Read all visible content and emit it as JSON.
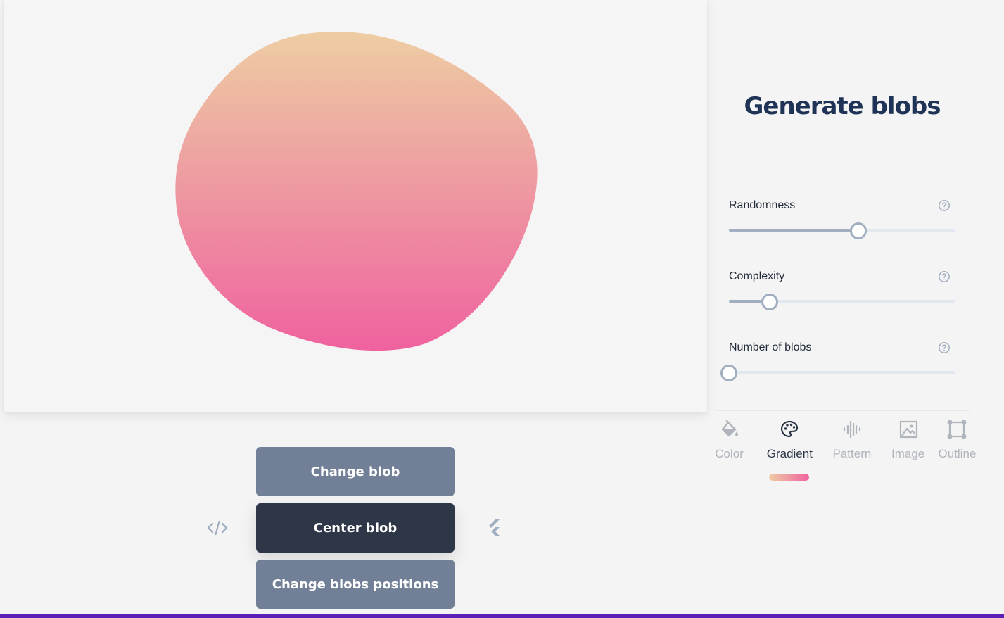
{
  "canvas": {
    "blob": {
      "gradient_start": "#eecda3",
      "gradient_end": "#ef629f"
    }
  },
  "actions": {
    "change_blob": "Change blob",
    "center_blob": "Center blob",
    "change_positions": "Change blobs positions",
    "code_icon": "code-icon",
    "flutter_icon": "flutter-icon"
  },
  "panel": {
    "title": "Generate blobs",
    "controls": [
      {
        "label": "Randomness",
        "value_percent": 57,
        "help_icon": "help-circle-icon"
      },
      {
        "label": "Complexity",
        "value_percent": 18,
        "help_icon": "help-circle-icon"
      },
      {
        "label": "Number of blobs",
        "value_percent": 0,
        "help_icon": "help-circle-icon"
      }
    ],
    "tabs": [
      {
        "label": "Color",
        "icon": "paint-bucket-icon",
        "active": false
      },
      {
        "label": "Gradient",
        "icon": "palette-icon",
        "active": true
      },
      {
        "label": "Pattern",
        "icon": "waveform-icon",
        "active": false
      },
      {
        "label": "Image",
        "icon": "image-icon",
        "active": false
      },
      {
        "label": "Outline",
        "icon": "outline-square-icon",
        "active": false
      }
    ],
    "active_indicator_colors": [
      "#eecda3",
      "#ef629f"
    ]
  },
  "theme": {
    "accent_bar": "#5b21b6",
    "button_primary": "#718096",
    "button_dark": "#2d3748",
    "title_color": "#1e3355"
  }
}
